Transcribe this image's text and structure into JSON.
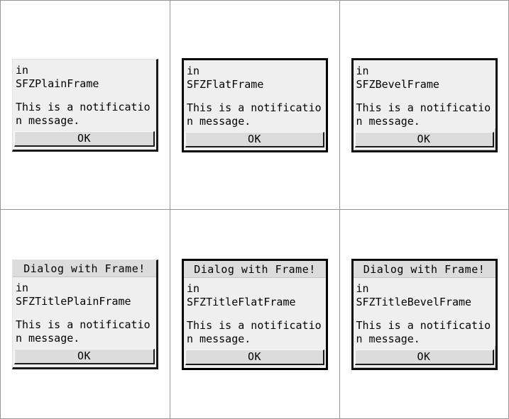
{
  "common": {
    "where_prefix": "in",
    "message": "This is a notification message.",
    "ok_label": "OK",
    "title_text": "Dialog with Frame!",
    "colors": {
      "dialog_background": "#efefef",
      "titlebar_background": "#dcdcdc",
      "button_face": "#dcdcdc",
      "border_dark": "#000000",
      "grid_separator": "#969696",
      "page_background": "#ffffff",
      "text": "#000000"
    }
  },
  "cells": [
    {
      "id": "cell-plain",
      "frame_style": "plain",
      "has_titlebar": false,
      "title": "",
      "where_prefix": "in",
      "class_name": "SFZPlainFrame",
      "message": "This is a notification message.",
      "ok_label": "OK"
    },
    {
      "id": "cell-flat",
      "frame_style": "flat",
      "has_titlebar": false,
      "title": "",
      "where_prefix": "in",
      "class_name": "SFZFlatFrame",
      "message": "This is a notification message.",
      "ok_label": "OK"
    },
    {
      "id": "cell-bevel",
      "frame_style": "bevel",
      "has_titlebar": false,
      "title": "",
      "where_prefix": "in",
      "class_name": "SFZBevelFrame",
      "message": "This is a notification message.",
      "ok_label": "OK"
    },
    {
      "id": "cell-title-plain",
      "frame_style": "plain",
      "has_titlebar": true,
      "title": "Dialog with Frame!",
      "where_prefix": "in",
      "class_name": "SFZTitlePlainFrame",
      "message": "This is a notification message.",
      "ok_label": "OK"
    },
    {
      "id": "cell-title-flat",
      "frame_style": "flat",
      "has_titlebar": true,
      "title": "Dialog with Frame!",
      "where_prefix": "in",
      "class_name": "SFZTitleFlatFrame",
      "message": "This is a notification message.",
      "ok_label": "OK"
    },
    {
      "id": "cell-title-bevel",
      "frame_style": "bevel",
      "has_titlebar": true,
      "title": "Dialog with Frame!",
      "where_prefix": "in",
      "class_name": "SFZTitleBevelFrame",
      "message": "This is a notification message.",
      "ok_label": "OK"
    }
  ]
}
